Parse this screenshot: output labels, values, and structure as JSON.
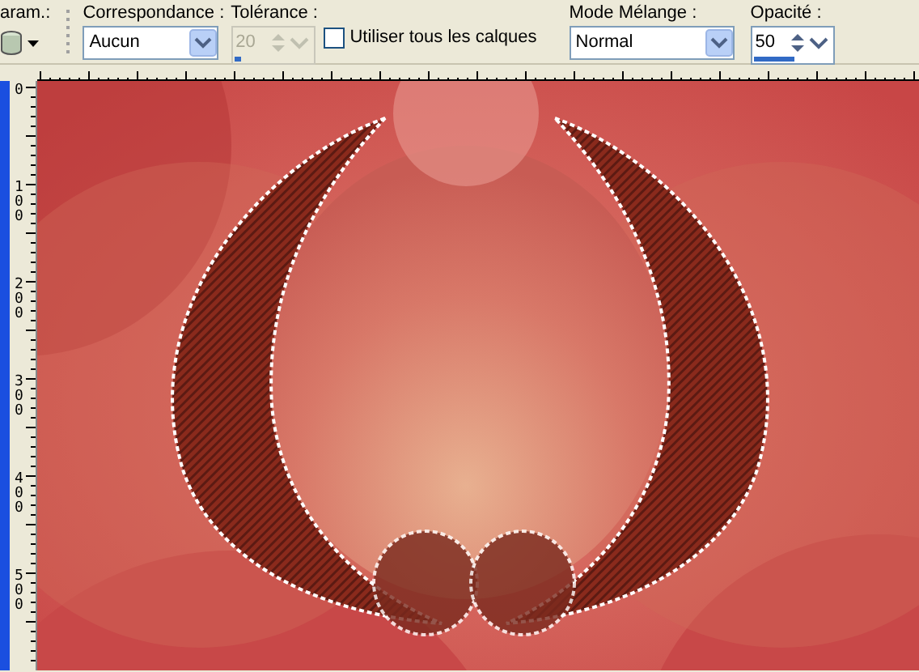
{
  "toolbar": {
    "presets_label": "aram.:",
    "match": {
      "label": "Correspondance :",
      "value": "Aucun"
    },
    "tolerance": {
      "label": "Tolérance :",
      "value": "20",
      "disabled": true,
      "level": 0.08
    },
    "use_all_layers": {
      "label": "Utiliser tous les calques",
      "checked": false
    },
    "blend_mode": {
      "label": "Mode Mélange :",
      "value": "Normal"
    },
    "opacity": {
      "label": "Opacité :",
      "value": "50",
      "disabled": false,
      "level": 0.5
    }
  },
  "rulers": {
    "left_labels": [
      "0",
      "100",
      "200",
      "300",
      "400",
      "500"
    ]
  }
}
